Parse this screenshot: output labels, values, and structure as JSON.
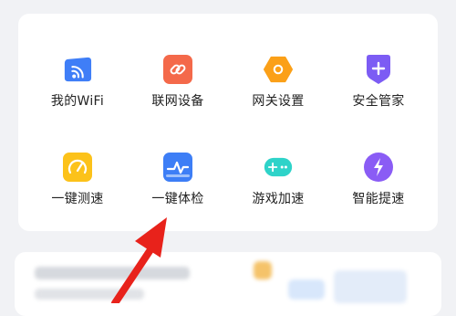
{
  "colors": {
    "background": "#f1f2f5",
    "card": "#ffffff",
    "text": "#222222",
    "arrow": "#e8221b"
  },
  "grid": {
    "items": [
      {
        "label": "我的WiFi",
        "icon": "wifi-icon",
        "color": "#3f7ef7"
      },
      {
        "label": "联网设备",
        "icon": "link-icon",
        "color": "#f4694a"
      },
      {
        "label": "网关设置",
        "icon": "hexagon-gateway-icon",
        "color": "#fba018"
      },
      {
        "label": "安全管家",
        "icon": "shield-plus-icon",
        "color": "#7c5cf4"
      },
      {
        "label": "一键测速",
        "icon": "speed-gauge-icon",
        "color": "#fcc21a"
      },
      {
        "label": "一键体检",
        "icon": "health-check-icon",
        "color": "#3d7ef6"
      },
      {
        "label": "游戏加速",
        "icon": "gamepad-icon",
        "color": "#2ed3c9"
      },
      {
        "label": "智能提速",
        "icon": "lightning-icon",
        "color": "#8a5cf5"
      }
    ]
  }
}
